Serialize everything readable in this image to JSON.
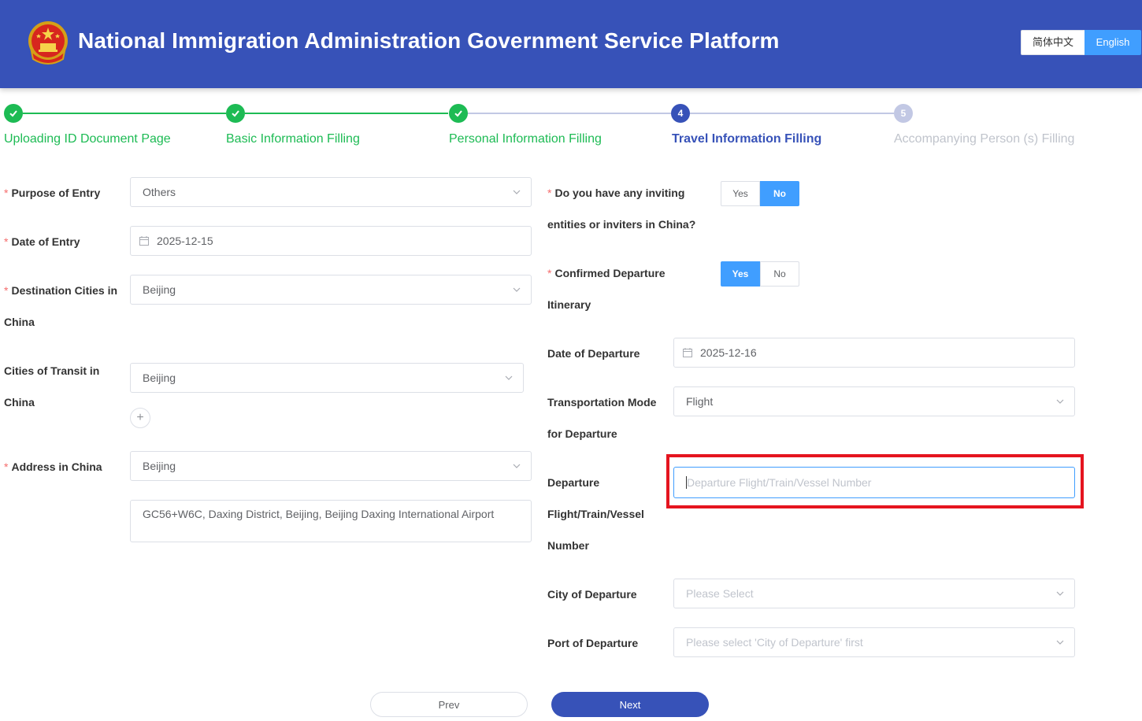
{
  "header": {
    "title": "National Immigration Administration Government Service Platform",
    "lang_zh": "简体中文",
    "lang_en": "English",
    "active_language": "English"
  },
  "steps": [
    {
      "label": "Uploading ID Document Page",
      "status": "done",
      "number": ""
    },
    {
      "label": "Basic Information Filling",
      "status": "done",
      "number": ""
    },
    {
      "label": "Personal Information Filling",
      "status": "done",
      "number": ""
    },
    {
      "label": "Travel Information Filling",
      "status": "active",
      "number": "4"
    },
    {
      "label": "Accompanying Person (s) Filling",
      "status": "todo",
      "number": "5"
    }
  ],
  "left": {
    "purpose_label": "Purpose of Entry",
    "purpose_value": "Others",
    "entry_date_label": "Date of Entry",
    "entry_date_value": "2025-12-15",
    "destination_label_1": "Destination Cities in",
    "destination_label_2": "China",
    "destination_value": "Beijing",
    "transit_label_1": "Cities of Transit in",
    "transit_label_2": "China",
    "transit_value": "Beijing",
    "add_symbol": "+",
    "address_label": "Address in China",
    "address_city": "Beijing",
    "address_detail": "GC56+W6C, Daxing District, Beijing, Beijing Daxing International Airport"
  },
  "right": {
    "inviting_label_1": "Do you have any inviting",
    "inviting_label_2": "entities or inviters in China?",
    "inviting_yes": "Yes",
    "inviting_no": "No",
    "inviting_selected": "No",
    "confirmed_label_1": "Confirmed Departure",
    "confirmed_label_2": "Itinerary",
    "confirmed_yes": "Yes",
    "confirmed_no": "No",
    "confirmed_selected": "Yes",
    "departure_date_label": "Date of Departure",
    "departure_date_value": "2025-12-16",
    "transport_label_1": "Transportation Mode",
    "transport_label_2": "for Departure",
    "transport_value": "Flight",
    "number_label_1": "Departure",
    "number_label_2": "Flight/Train/Vessel",
    "number_label_3": "Number",
    "number_placeholder": "Departure Flight/Train/Vessel Number",
    "city_label": "City of Departure",
    "city_placeholder": "Please Select",
    "port_label": "Port of Departure",
    "port_placeholder": "Please select 'City of Departure' first"
  },
  "buttons": {
    "prev": "Prev",
    "next": "Next"
  },
  "colors": {
    "header_bg": "#3752b8",
    "step_done": "#1dbb54",
    "step_active": "#3752b8",
    "step_todo": "#c2c8e4",
    "accent": "#409eff",
    "highlight": "#e5141f"
  }
}
